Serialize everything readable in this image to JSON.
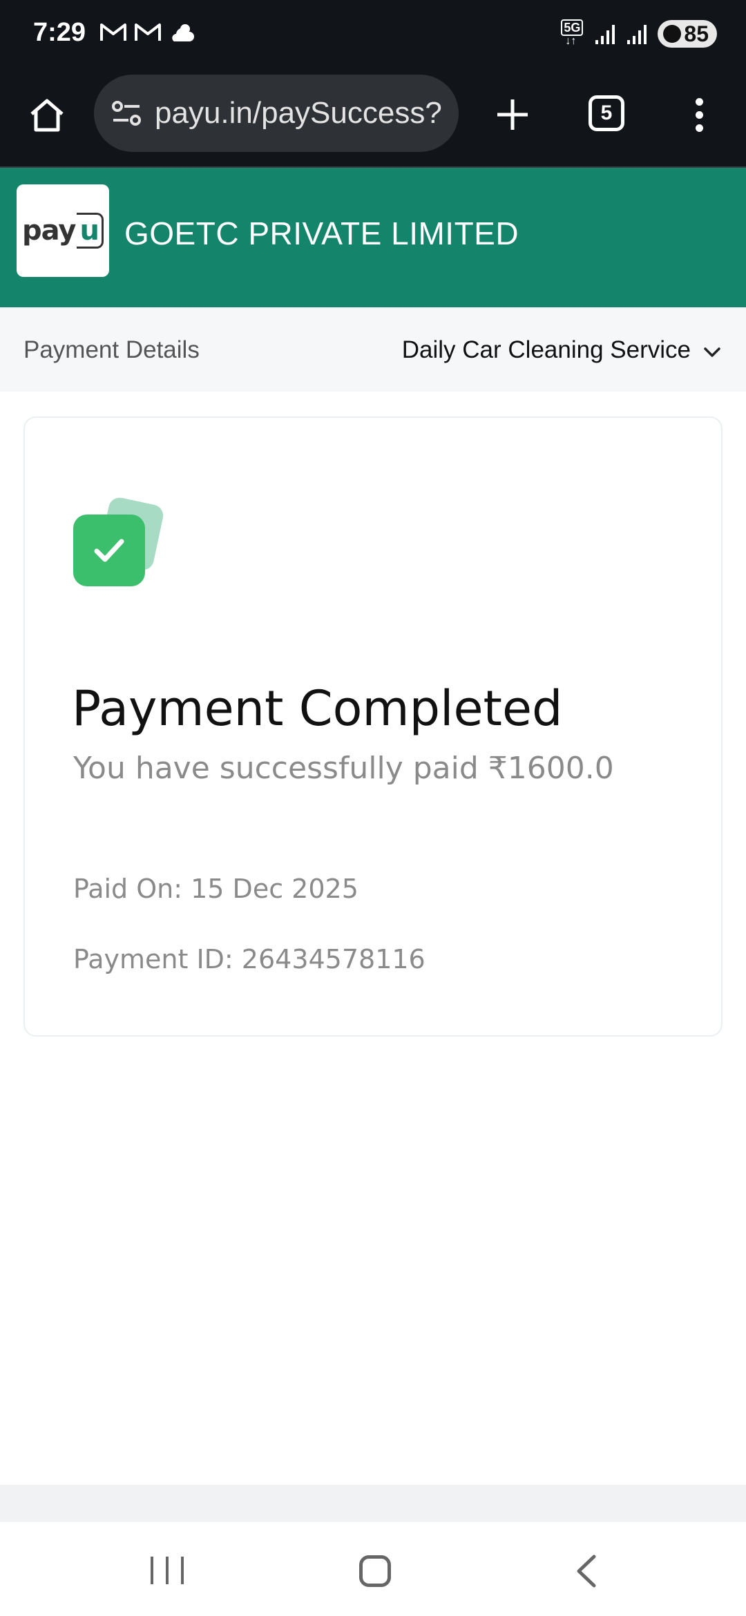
{
  "status_bar": {
    "time": "7:29",
    "network": "5G",
    "battery": "85",
    "icons": [
      "gmail-icon",
      "gmail-icon",
      "weather-icon",
      "signal-icon",
      "signal-icon",
      "battery-icon"
    ]
  },
  "browser": {
    "url": "payu.in/paySuccess?",
    "tab_count": "5"
  },
  "merchant": {
    "logo_text": "pay",
    "logo_u": "u",
    "name": "GOETC PRIVATE LIMITED",
    "brand_color": "#14856b"
  },
  "details_bar": {
    "label": "Payment Details",
    "product": "Daily Car Cleaning Service"
  },
  "result": {
    "title": "Payment Completed",
    "subtitle": "You have successfully paid ₹1600.0",
    "paid_on": "Paid On: 15 Dec 2025",
    "payment_id": "Payment ID: 26434578116",
    "status_color": "#3cbf6c"
  }
}
